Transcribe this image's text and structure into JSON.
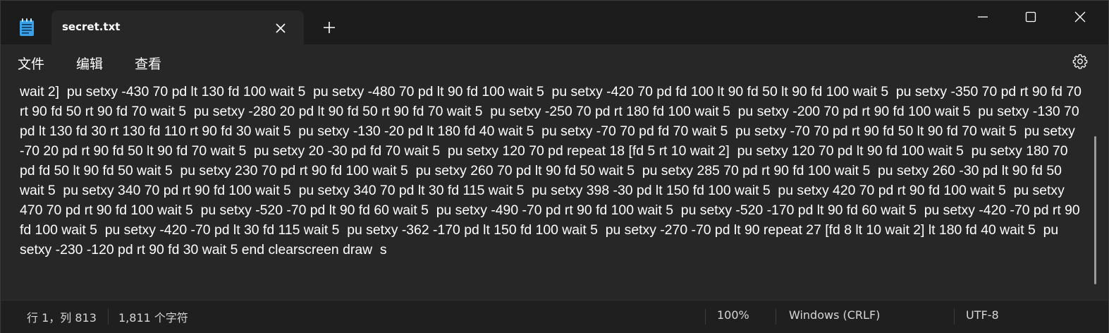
{
  "window": {
    "tab_title": "secret.txt",
    "icons": {
      "app": "notepad-icon",
      "tab_close": "close-icon",
      "new_tab": "plus-icon",
      "minimize": "minimize-icon",
      "maximize": "maximize-icon",
      "close": "close-icon",
      "settings": "gear-icon"
    }
  },
  "menu": {
    "file": "文件",
    "edit": "编辑",
    "view": "查看"
  },
  "editor": {
    "text": "wait 2]  pu setxy -430 70 pd lt 130 fd 100 wait 5  pu setxy -480 70 pd lt 90 fd 100 wait 5  pu setxy -420 70 pd fd 100 lt 90 fd 50 lt 90 fd 100 wait 5  pu setxy -350 70 pd rt 90 fd 70 rt 90 fd 50 rt 90 fd 70 wait 5  pu setxy -280 20 pd lt 90 fd 50 rt 90 fd 70 wait 5  pu setxy -250 70 pd rt 180 fd 100 wait 5  pu setxy -200 70 pd rt 90 fd 100 wait 5  pu setxy -130 70 pd lt 130 fd 30 rt 130 fd 110 rt 90 fd 30 wait 5  pu setxy -130 -20 pd lt 180 fd 40 wait 5  pu setxy -70 70 pd fd 70 wait 5  pu setxy -70 70 pd rt 90 fd 50 lt 90 fd 70 wait 5  pu setxy -70 20 pd rt 90 fd 50 lt 90 fd 70 wait 5  pu setxy 20 -30 pd fd 70 wait 5  pu setxy 120 70 pd repeat 18 [fd 5 rt 10 wait 2]  pu setxy 120 70 pd lt 90 fd 100 wait 5  pu setxy 180 70 pd fd 50 lt 90 fd 50 wait 5  pu setxy 230 70 pd rt 90 fd 100 wait 5  pu setxy 260 70 pd lt 90 fd 50 wait 5  pu setxy 285 70 pd rt 90 fd 100 wait 5  pu setxy 260 -30 pd lt 90 fd 50 wait 5  pu setxy 340 70 pd rt 90 fd 100 wait 5  pu setxy 340 70 pd lt 30 fd 115 wait 5  pu setxy 398 -30 pd lt 150 fd 100 wait 5  pu setxy 420 70 pd rt 90 fd 100 wait 5  pu setxy 470 70 pd rt 90 fd 100 wait 5  pu setxy -520 -70 pd lt 90 fd 60 wait 5  pu setxy -490 -70 pd rt 90 fd 100 wait 5  pu setxy -520 -170 pd lt 90 fd 60 wait 5  pu setxy -420 -70 pd rt 90 fd 100 wait 5  pu setxy -420 -70 pd lt 30 fd 115 wait 5  pu setxy -362 -170 pd lt 150 fd 100 wait 5  pu setxy -270 -70 pd lt 90 repeat 27 [fd 8 lt 10 wait 2] lt 180 fd 40 wait 5  pu setxy -230 -120 pd rt 90 fd 30 wait 5 end clearscreen draw  s"
  },
  "status": {
    "position": "行 1，列 813",
    "char_count": "1,811 个字符",
    "zoom": "100%",
    "line_ending": "Windows (CRLF)",
    "encoding": "UTF-8"
  },
  "colors": {
    "titlebar": "#1c1c1c",
    "editor_bg": "#272727",
    "text": "#ffffff",
    "app_icon": "#3aa0e8"
  }
}
